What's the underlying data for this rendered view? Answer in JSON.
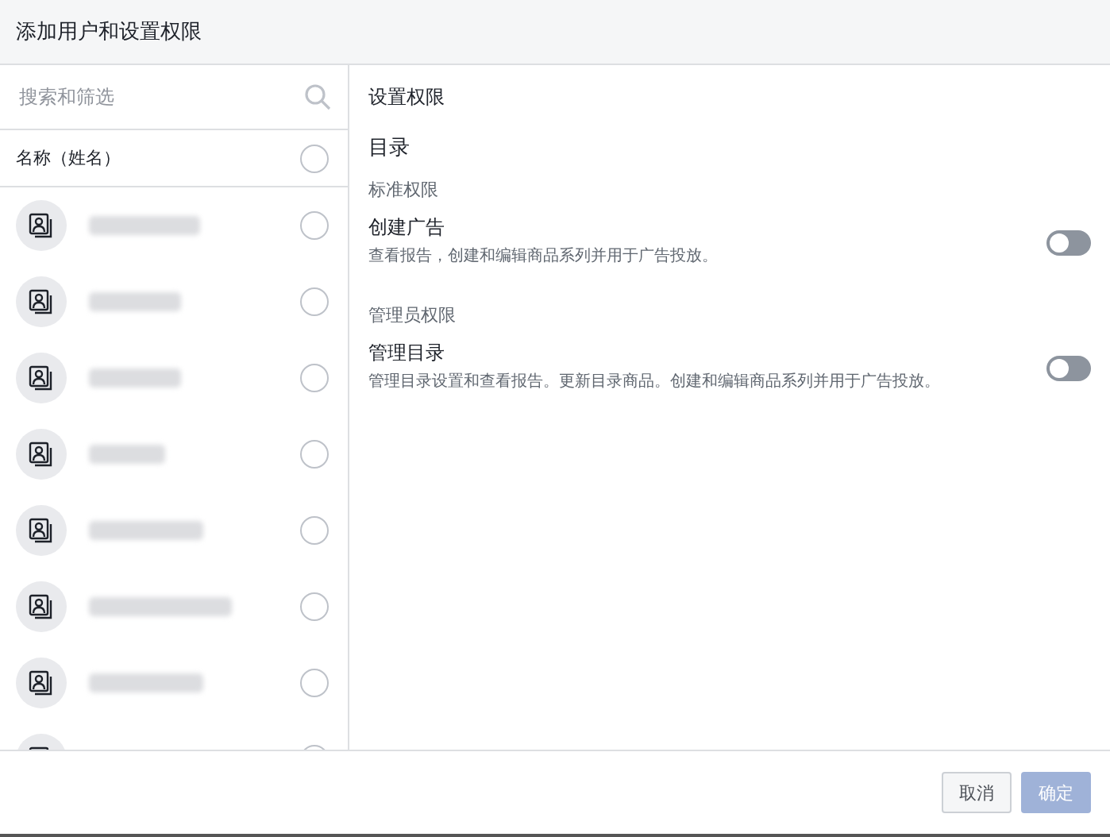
{
  "window": {
    "title": "添加用户和设置权限"
  },
  "search": {
    "placeholder": "搜索和筛选"
  },
  "list_header": {
    "label": "名称（姓名）",
    "checked": false
  },
  "users": [
    {
      "kind": "redacted",
      "checked": false
    },
    {
      "kind": "redacted",
      "checked": false
    },
    {
      "kind": "redacted",
      "checked": false
    },
    {
      "kind": "redacted",
      "checked": false
    },
    {
      "kind": "redacted",
      "checked": false
    },
    {
      "kind": "redacted",
      "checked": false
    },
    {
      "kind": "redacted",
      "checked": false
    },
    {
      "kind": "partial",
      "checked": false
    }
  ],
  "permissions": {
    "title": "设置权限",
    "section": "目录",
    "groups": [
      {
        "heading": "标准权限",
        "items": [
          {
            "name": "创建广告",
            "description": "查看报告，创建和编辑商品系列并用于广告投放。",
            "on": false
          }
        ]
      },
      {
        "heading": "管理员权限",
        "items": [
          {
            "name": "管理目录",
            "description": "管理目录设置和查看报告。更新目录商品。创建和编辑商品系列并用于广告投放。",
            "on": false
          }
        ]
      }
    ]
  },
  "buttons": [
    {
      "label": "取消",
      "kind": "secondary",
      "disabled": false
    },
    {
      "label": "确定",
      "kind": "primary",
      "disabled": true
    }
  ]
}
